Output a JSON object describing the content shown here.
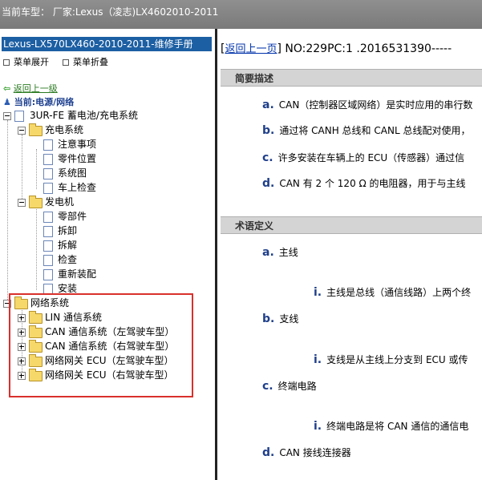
{
  "window": {
    "title": "当前车型：  厂家:Lexus（凌志)LX4602010-2011"
  },
  "left": {
    "manual_title": "Lexus-LX570LX460-2010-2011-维修手册",
    "expand_menu": "菜单展开",
    "collapse_menu": "菜单折叠",
    "back_link": "返回上一级",
    "current_label": "当前:电源/网络",
    "tree": {
      "root": "3UR-FE 蓄电池/充电系统",
      "charging": {
        "label": "充电系统",
        "children": [
          "注意事项",
          "零件位置",
          "系统图",
          "车上检查"
        ]
      },
      "generator": {
        "label": "发电机",
        "children": [
          "零部件",
          "拆卸",
          "拆解",
          "检查",
          "重新装配",
          "安装"
        ]
      },
      "network": {
        "label": "网络系统",
        "children": [
          "LIN 通信系统",
          "CAN 通信系统（左驾驶车型）",
          "CAN 通信系统（右驾驶车型）",
          "网络网关 ECU（左驾驶车型）",
          "网络网关 ECU（右驾驶车型）"
        ]
      }
    }
  },
  "right": {
    "back_link": "返回上一页",
    "doc_id": "NO:229PC:1 .2016531390-----",
    "section1": {
      "title": "简要描述",
      "items": [
        {
          "marker": "a.",
          "text": "CAN（控制器区域网络）是实时应用的串行数"
        },
        {
          "marker": "b.",
          "text": "通过将 CANH 总线和 CANL 总线配对使用，"
        },
        {
          "marker": "c.",
          "text": "许多安装在车辆上的 ECU（传感器）通过信"
        },
        {
          "marker": "d.",
          "text": "CAN 有 2 个 120 Ω 的电阻器，用于与主线"
        }
      ]
    },
    "section2": {
      "title": "术语定义",
      "items": [
        {
          "marker": "a.",
          "text": "主线"
        },
        {
          "marker": "i.",
          "text": "主线是总线（通信线路）上两个终"
        },
        {
          "marker": "b.",
          "text": "支线"
        },
        {
          "marker": "i.",
          "text": "支线是从主线上分支到 ECU 或传"
        },
        {
          "marker": "c.",
          "text": "终端电路"
        },
        {
          "marker": "i.",
          "text": "终端电路是将 CAN 通信的通信电"
        },
        {
          "marker": "d.",
          "text": "CAN 接线连接器"
        }
      ]
    }
  },
  "colors": {
    "title_bar": "#868686",
    "manual_title_bg": "#1c5fa3",
    "highlight": "#d9302c",
    "section_bar": "#d4d4d4",
    "marker": "#1f3f8a"
  }
}
